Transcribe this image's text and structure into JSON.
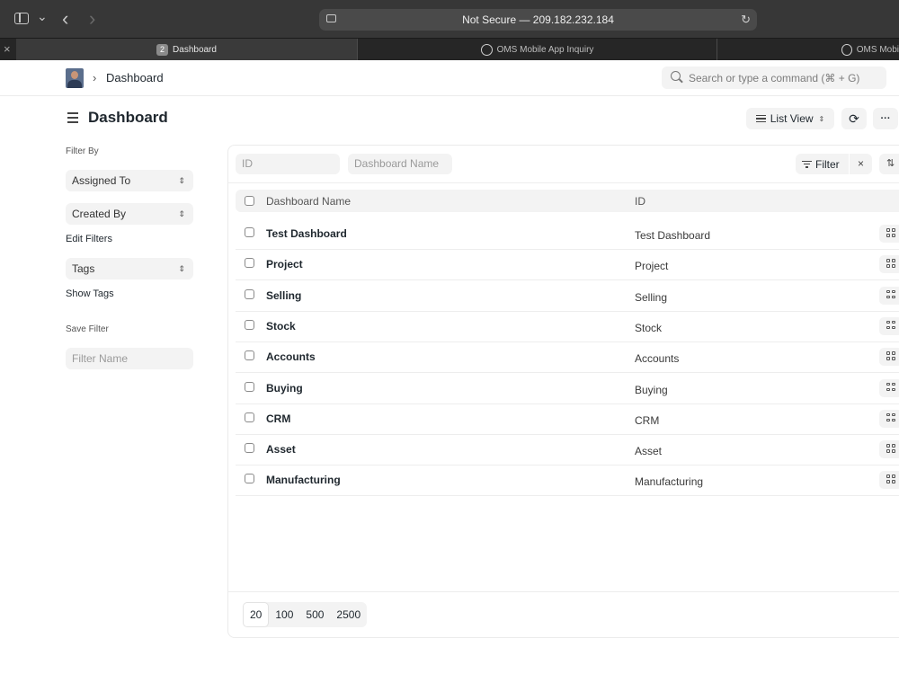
{
  "browser": {
    "url_text": "Not Secure — 209.182.232.184",
    "tabs": [
      {
        "badge": "2",
        "label": "Dashboard"
      },
      {
        "label": "OMS Mobile App Inquiry"
      },
      {
        "label": "OMS Mobi"
      }
    ],
    "close_glyph": "×",
    "back_glyph": "‹",
    "forward_glyph": "›",
    "reload_glyph": "↻",
    "dropdown_glyph": "⌄"
  },
  "header": {
    "breadcrumb_sep": "›",
    "breadcrumb": "Dashboard",
    "search_placeholder": "Search or type a command (⌘ + G)"
  },
  "page": {
    "title": "Dashboard",
    "list_view_label": "List View",
    "list_view_icon": "list-icon",
    "refresh_glyph": "⟳",
    "more_glyph": "···"
  },
  "sidebar": {
    "filter_by_label": "Filter By",
    "assigned_to": "Assigned To",
    "created_by": "Created By",
    "edit_filters": "Edit Filters",
    "tags": "Tags",
    "show_tags": "Show Tags",
    "save_filter_label": "Save Filter",
    "filter_name_placeholder": "Filter Name",
    "select_arrow": "⌃⌄"
  },
  "list": {
    "id_placeholder": "ID",
    "name_placeholder": "Dashboard Name",
    "filter_label": "Filter",
    "clear_glyph": "×",
    "sort_glyph": "⇅",
    "columns": {
      "name": "Dashboard Name",
      "id": "ID"
    },
    "rows": [
      {
        "name": "Test Dashboard",
        "id": "Test Dashboard"
      },
      {
        "name": "Project",
        "id": "Project"
      },
      {
        "name": "Selling",
        "id": "Selling"
      },
      {
        "name": "Stock",
        "id": "Stock"
      },
      {
        "name": "Accounts",
        "id": "Accounts"
      },
      {
        "name": "Buying",
        "id": "Buying"
      },
      {
        "name": "CRM",
        "id": "CRM"
      },
      {
        "name": "Asset",
        "id": "Asset"
      },
      {
        "name": "Manufacturing",
        "id": "Manufacturing"
      }
    ],
    "page_sizes": [
      "20",
      "100",
      "500",
      "2500"
    ],
    "selected_page_size": "20"
  }
}
